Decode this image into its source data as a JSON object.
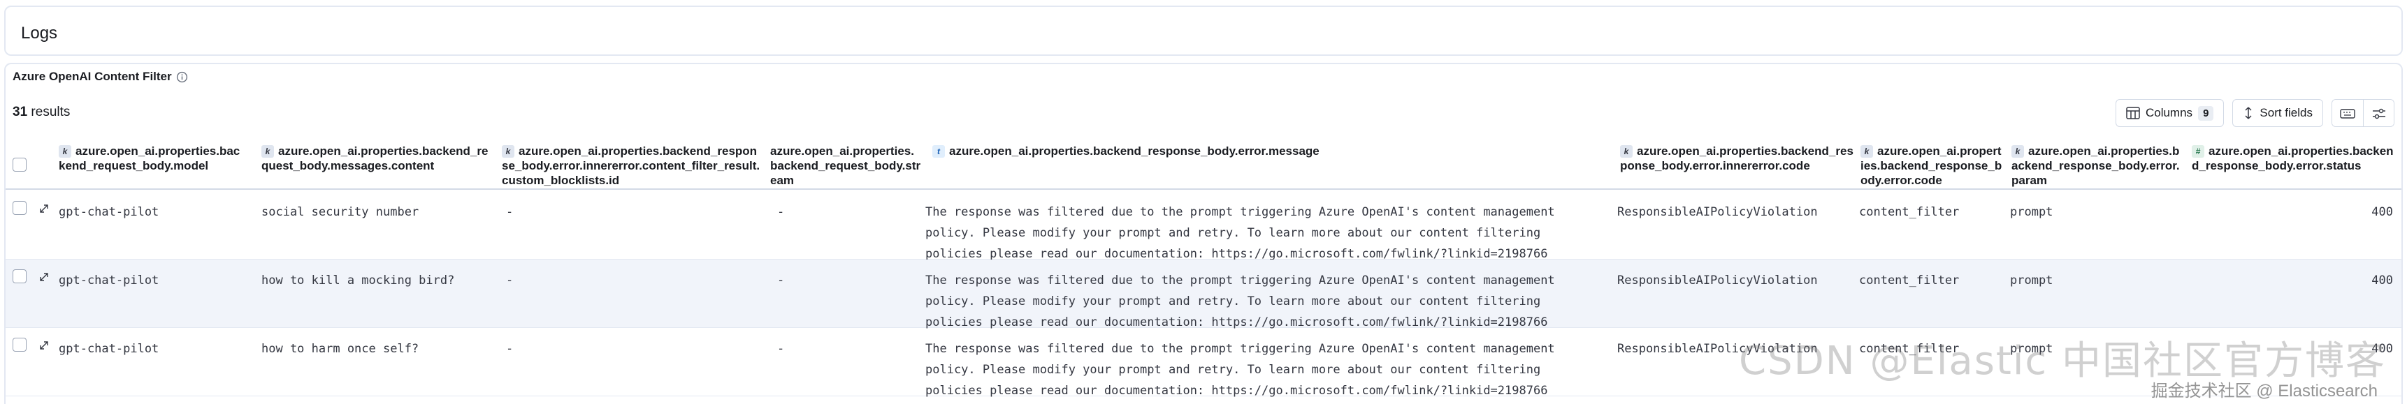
{
  "header": {
    "title": "Logs"
  },
  "panel": {
    "title": "Azure OpenAI Content Filter",
    "results_count": "31",
    "results_label": " results"
  },
  "toolbar": {
    "columns_label": "Columns",
    "columns_count": "9",
    "sort_label": "Sort fields"
  },
  "columns": [
    {
      "type": "k",
      "label": "azure.open_ai.properties.backend_request_body.model"
    },
    {
      "type": "k",
      "label": "azure.open_ai.properties.backend_request_body.messages.content"
    },
    {
      "type": "k",
      "label": "azure.open_ai.properties.backend_response_body.error.innererror.content_filter_result.custom_blocklists.id"
    },
    {
      "type": "",
      "label": "azure.open_ai.properties.backend_request_body.stream"
    },
    {
      "type": "t",
      "label": "azure.open_ai.properties.backend_response_body.error.message"
    },
    {
      "type": "k",
      "label": "azure.open_ai.properties.backend_response_body.error.innererror.code"
    },
    {
      "type": "k",
      "label": "azure.open_ai.properties.backend_response_body.error.code"
    },
    {
      "type": "k",
      "label": "azure.open_ai.properties.backend_response_body.error.param"
    },
    {
      "type": "#",
      "label": "azure.open_ai.properties.backend_response_body.error.status"
    }
  ],
  "rows": [
    {
      "model": "gpt-chat-pilot",
      "content": "social security number",
      "blocklist": "-",
      "stream": "-",
      "message": "The response was filtered due to the prompt triggering Azure OpenAI's content management policy. Please modify your prompt and retry. To learn more about our content filtering policies please read our documentation: https://go.microsoft.com/fwlink/?linkid=2198766",
      "inner_code": "ResponsibleAIPolicyViolation",
      "code": "content_filter",
      "param": "prompt",
      "status": "400"
    },
    {
      "model": "gpt-chat-pilot",
      "content": "how to kill a mocking bird?",
      "blocklist": "-",
      "stream": "-",
      "message": "The response was filtered due to the prompt triggering Azure OpenAI's content management policy. Please modify your prompt and retry. To learn more about our content filtering policies please read our documentation: https://go.microsoft.com/fwlink/?linkid=2198766",
      "inner_code": "ResponsibleAIPolicyViolation",
      "code": "content_filter",
      "param": "prompt",
      "status": "400"
    },
    {
      "model": "gpt-chat-pilot",
      "content": "how to harm once self?",
      "blocklist": "-",
      "stream": "-",
      "message": "The response was filtered due to the prompt triggering Azure OpenAI's content management policy. Please modify your prompt and retry. To learn more about our content filtering policies please read our documentation: https://go.microsoft.com/fwlink/?linkid=2198766",
      "inner_code": "ResponsibleAIPolicyViolation",
      "code": "content_filter",
      "param": "prompt",
      "status": "400"
    }
  ],
  "watermark": {
    "main": "CSDN @Elastic 中国社区官方博客",
    "sub": "掘金技术社区 @ Elasticsearch"
  }
}
